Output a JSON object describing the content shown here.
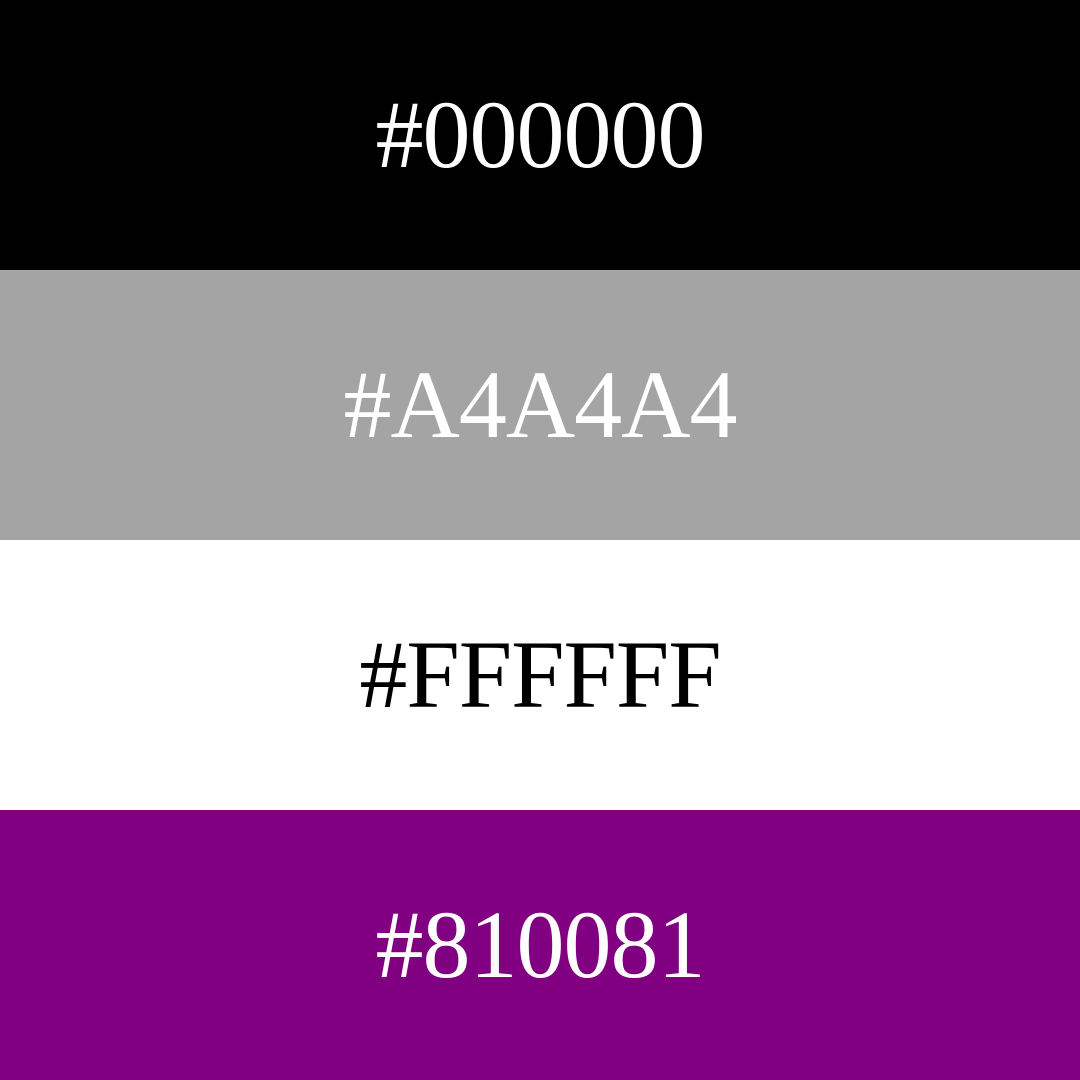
{
  "swatches": [
    {
      "label": "#000000",
      "background": "#000000",
      "text_color": "#FFFFFF"
    },
    {
      "label": "#A4A4A4",
      "background": "#A4A4A4",
      "text_color": "#FFFFFF"
    },
    {
      "label": "#FFFFFF",
      "background": "#FFFFFF",
      "text_color": "#000000"
    },
    {
      "label": "#810081",
      "background": "#810081",
      "text_color": "#FFFFFF"
    }
  ]
}
